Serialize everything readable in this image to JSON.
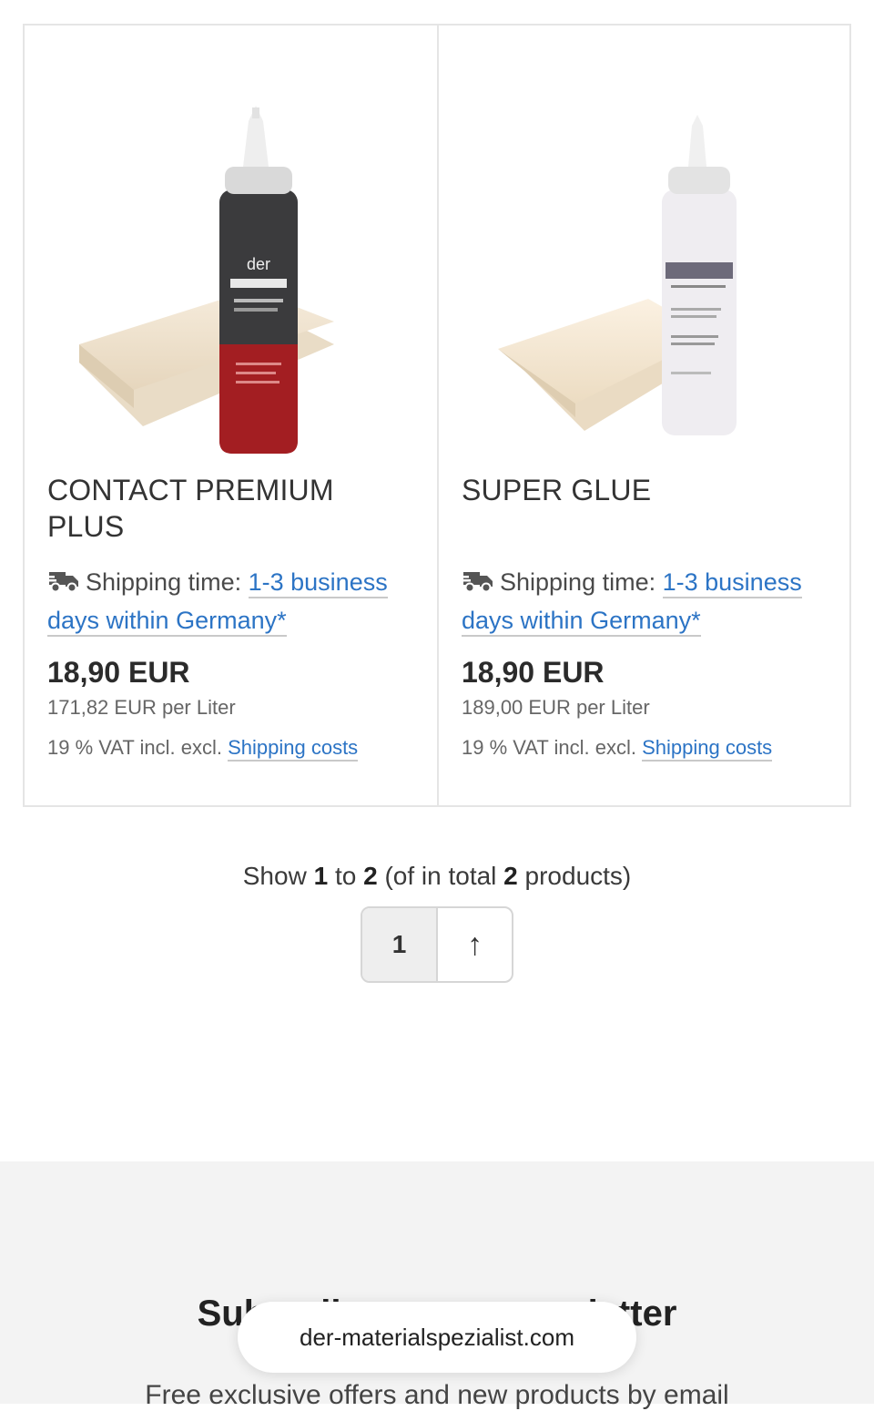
{
  "products": [
    {
      "name": "CONTACT PREMIUM PLUS",
      "shipping_label": "Shipping time:",
      "shipping_link": "1-3 business days within Germany*",
      "price": "18,90 EUR",
      "unit_price": "171,82 EUR per Liter",
      "vat_text": "19 % VAT incl. excl.",
      "shipping_costs_link": "Shipping costs",
      "image_icon": "dark-glue-bottle-image"
    },
    {
      "name": "SUPER GLUE",
      "shipping_label": "Shipping time:",
      "shipping_link": "1-3 business days within Germany*",
      "price": "18,90 EUR",
      "unit_price": "189,00 EUR per Liter",
      "vat_text": "19 % VAT incl. excl.",
      "shipping_costs_link": "Shipping costs",
      "image_icon": "white-glue-bottle-image"
    }
  ],
  "pagination": {
    "show": "Show",
    "from": "1",
    "to_word": "to",
    "to": "2",
    "of_text": "(of in total",
    "total": "2",
    "products_word": "products)",
    "current_page": "1",
    "up_icon": "↑"
  },
  "newsletter": {
    "title": "Subscribe to our newsletter",
    "text": "Free exclusive offers and new products by email"
  },
  "browser": {
    "url": "der-materialspezialist.com"
  },
  "colors": {
    "link": "#2c74c5",
    "border": "#e5e5e5",
    "footer_bg": "#f3f3f3"
  }
}
